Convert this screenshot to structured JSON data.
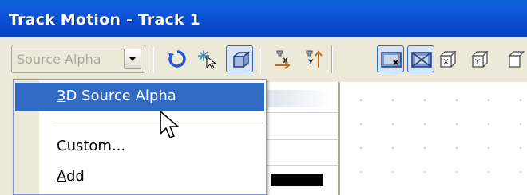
{
  "window": {
    "title": "Track Motion - Track 1"
  },
  "toolbar": {
    "source_combo": {
      "value": "Source Alpha"
    },
    "buttons": [
      {
        "icon": "reset-rotate-icon"
      },
      {
        "icon": "enable-move-icon"
      },
      {
        "icon": "3d-box-icon",
        "checked": true
      },
      {
        "icon": "x-axis-snap-icon"
      },
      {
        "icon": "y-axis-snap-icon"
      },
      {
        "icon": "view-xy-icon",
        "checked": true
      },
      {
        "icon": "view-xz-icon",
        "checked": true
      },
      {
        "icon": "view-x-icon"
      },
      {
        "icon": "view-y-icon"
      }
    ]
  },
  "menu": {
    "items": [
      {
        "label": "3D Source Alpha",
        "accel_letter": "3",
        "highlighted": true
      },
      {
        "label": "Custom...",
        "highlighted": false
      },
      {
        "label": "Add",
        "accel_letter": "A",
        "highlighted": false
      }
    ]
  },
  "colors": {
    "titlebar": "#0a4fd2",
    "menu_highlight": "#316ac5",
    "face": "#ece9d8"
  }
}
